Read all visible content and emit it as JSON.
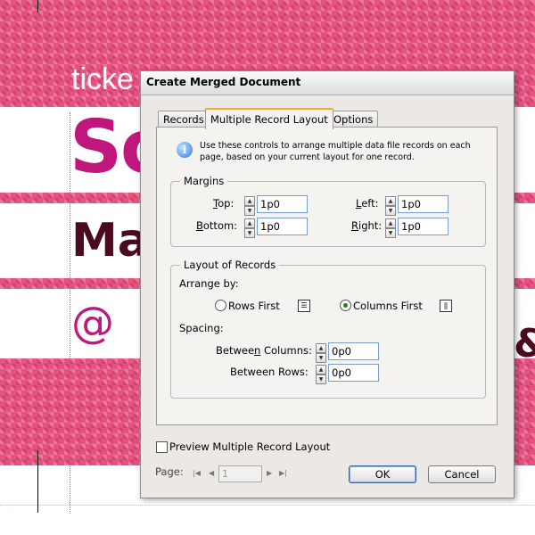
{
  "background": {
    "line_ticket": "ticke",
    "line_so": "So",
    "line_ma": "Ma",
    "line_at": "@",
    "right_glyph": "&"
  },
  "dialog": {
    "title": "Create Merged Document",
    "tabs": [
      {
        "label": "Records",
        "active": false
      },
      {
        "label": "Multiple Record Layout",
        "active": true
      },
      {
        "label": "Options",
        "active": false
      }
    ],
    "info_text": "Use these controls to arrange multiple data file records on each page, based on your current layout for one record.",
    "margins": {
      "group_label": "Margins",
      "top_label": "Top:",
      "top_value": "1p0",
      "bottom_label": "Bottom:",
      "bottom_value": "1p0",
      "left_label": "Left:",
      "left_value": "1p0",
      "right_label": "Right:",
      "right_value": "1p0"
    },
    "layout": {
      "group_label": "Layout of Records",
      "arrange_label": "Arrange by:",
      "rows_first_label": "Rows First",
      "rows_first_selected": false,
      "columns_first_label": "Columns First",
      "columns_first_selected": true,
      "spacing_label": "Spacing:",
      "between_columns_label": "Between Columns:",
      "between_columns_value": "0p0",
      "between_rows_label": "Between Rows:",
      "between_rows_value": "0p0"
    },
    "preview_label": "Preview Multiple Record Layout",
    "preview_checked": false,
    "page_label": "Page:",
    "page_value": "1",
    "ok_label": "OK",
    "cancel_label": "Cancel"
  }
}
